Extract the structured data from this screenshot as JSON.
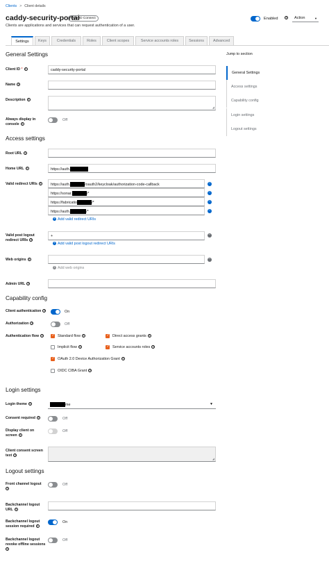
{
  "breadcrumb": {
    "root": "Clients",
    "sep": ">",
    "current": "Client details"
  },
  "header": {
    "title": "caddy-security-portal",
    "badge": "OpenID Connect",
    "subtitle": "Clients are applications and services that can request authentication of a user.",
    "enabled_label": "Enabled",
    "action_label": "Action",
    "help_glyph": "?"
  },
  "tabs": [
    "Settings",
    "Keys",
    "Credentials",
    "Roles",
    "Client scopes",
    "Service accounts roles",
    "Sessions",
    "Advanced"
  ],
  "jump": {
    "heading": "Jump to section",
    "items": [
      "General Settings",
      "Access settings",
      "Capability config",
      "Login settings",
      "Logout settings"
    ]
  },
  "general": {
    "heading": "General Settings",
    "client_id_label": "Client ID",
    "required_mark": "*",
    "client_id_value": "caddy-security-portal",
    "name_label": "Name",
    "description_label": "Description",
    "always_display_label_1": "Always display in",
    "always_display_label_2": "console",
    "always_display_state": "Off"
  },
  "access": {
    "heading": "Access settings",
    "root_url_label": "Root URL",
    "home_url_label": "Home URL",
    "home_url_value": "https://auth.",
    "valid_redirect_label": "Valid redirect URIs",
    "redirect_1a": "https://auth.",
    "redirect_1b": "/oauth2/keycloak/authorization-code-callback",
    "redirect_2a": "https://sonar.",
    "redirect_2b": "/*",
    "redirect_3a": "https://fabricatio",
    "redirect_3b": "/*",
    "redirect_4a": "https://auth.",
    "redirect_4b": "/*",
    "add_redirect": "Add valid redirect URIs",
    "logout_redirect_label_1": "Valid post logout",
    "logout_redirect_label_2": "redirect URIs",
    "logout_redirect_value": "+",
    "add_logout_redirect": "Add valid post logout redirect URIs",
    "web_origins_label": "Web origins",
    "add_web_origins": "Add web origins",
    "admin_url_label": "Admin URL"
  },
  "capability": {
    "heading": "Capability config",
    "client_auth_label": "Client authentication",
    "client_auth_state": "On",
    "authorization_label": "Authorization",
    "authorization_state": "Off",
    "flow_label": "Authentication flow",
    "standard_flow": "Standard flow",
    "direct_access": "Direct access grants",
    "implicit_flow": "Implicit flow",
    "service_accounts": "Service accounts roles",
    "oauth_device": "OAuth 2.0 Device Authorization Grant",
    "oidc_ciba": "OIDC CIBA Grant"
  },
  "login": {
    "heading": "Login settings",
    "theme_label": "Login theme",
    "theme_value": "me",
    "consent_label": "Consent required",
    "consent_state": "Off",
    "display_client_label_1": "Display client on",
    "display_client_label_2": "screen",
    "display_client_state": "Off",
    "consent_text_label_1": "Client consent screen",
    "consent_text_label_2": "text"
  },
  "logout": {
    "heading": "Logout settings",
    "front_label": "Front channel logout",
    "front_state": "Off",
    "back_url_label_1": "Backchannel logout",
    "back_url_label_2": "URL",
    "back_session_label_1": "Backchannel logout",
    "back_session_label_2": "session required",
    "back_session_state": "On",
    "back_offline_label_1": "Backchannel logout",
    "back_offline_label_2": "revoke offline sessions",
    "back_offline_state": "Off"
  },
  "colors": {
    "accent": "#0066cc",
    "checkbox": "#e8601c",
    "toggle_off": "#8a8d90"
  }
}
